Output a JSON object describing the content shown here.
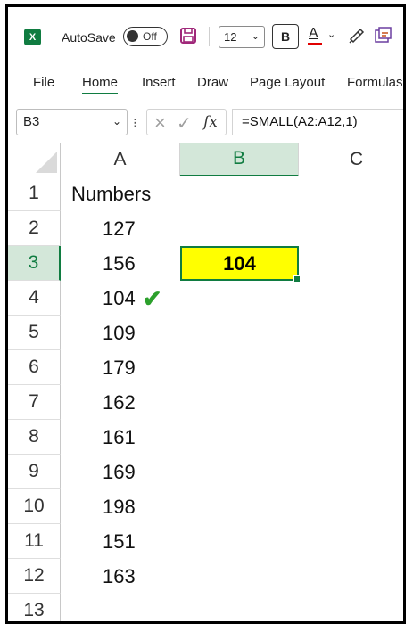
{
  "app": {
    "logo_letter": "X"
  },
  "qat": {
    "autosave_label": "AutoSave",
    "autosave_state": "Off",
    "font_size": "12",
    "bold_label": "B",
    "font_color_label": "A",
    "font_color": "#e00000"
  },
  "ribbon": {
    "tabs": [
      "File",
      "Home",
      "Insert",
      "Draw",
      "Page Layout",
      "Formulas"
    ],
    "active_tab": "Home"
  },
  "formula_bar": {
    "name_box": "B3",
    "fx_label": "fx",
    "formula": "=SMALL(A2:A12,1)"
  },
  "grid": {
    "columns": [
      "A",
      "B",
      "C"
    ],
    "selected_column": "B",
    "rows": [
      {
        "num": "1",
        "a": "Numbers"
      },
      {
        "num": "2",
        "a": "127"
      },
      {
        "num": "3",
        "a": "156",
        "b": "104",
        "selected": true
      },
      {
        "num": "4",
        "a": "104",
        "check": "✔"
      },
      {
        "num": "5",
        "a": "109"
      },
      {
        "num": "6",
        "a": "179"
      },
      {
        "num": "7",
        "a": "162"
      },
      {
        "num": "8",
        "a": "161"
      },
      {
        "num": "9",
        "a": "169"
      },
      {
        "num": "10",
        "a": "198"
      },
      {
        "num": "11",
        "a": "151"
      },
      {
        "num": "12",
        "a": "163"
      },
      {
        "num": "13",
        "a": ""
      }
    ],
    "result_fill_color": "#ffff00",
    "accent_color": "#107c41"
  }
}
